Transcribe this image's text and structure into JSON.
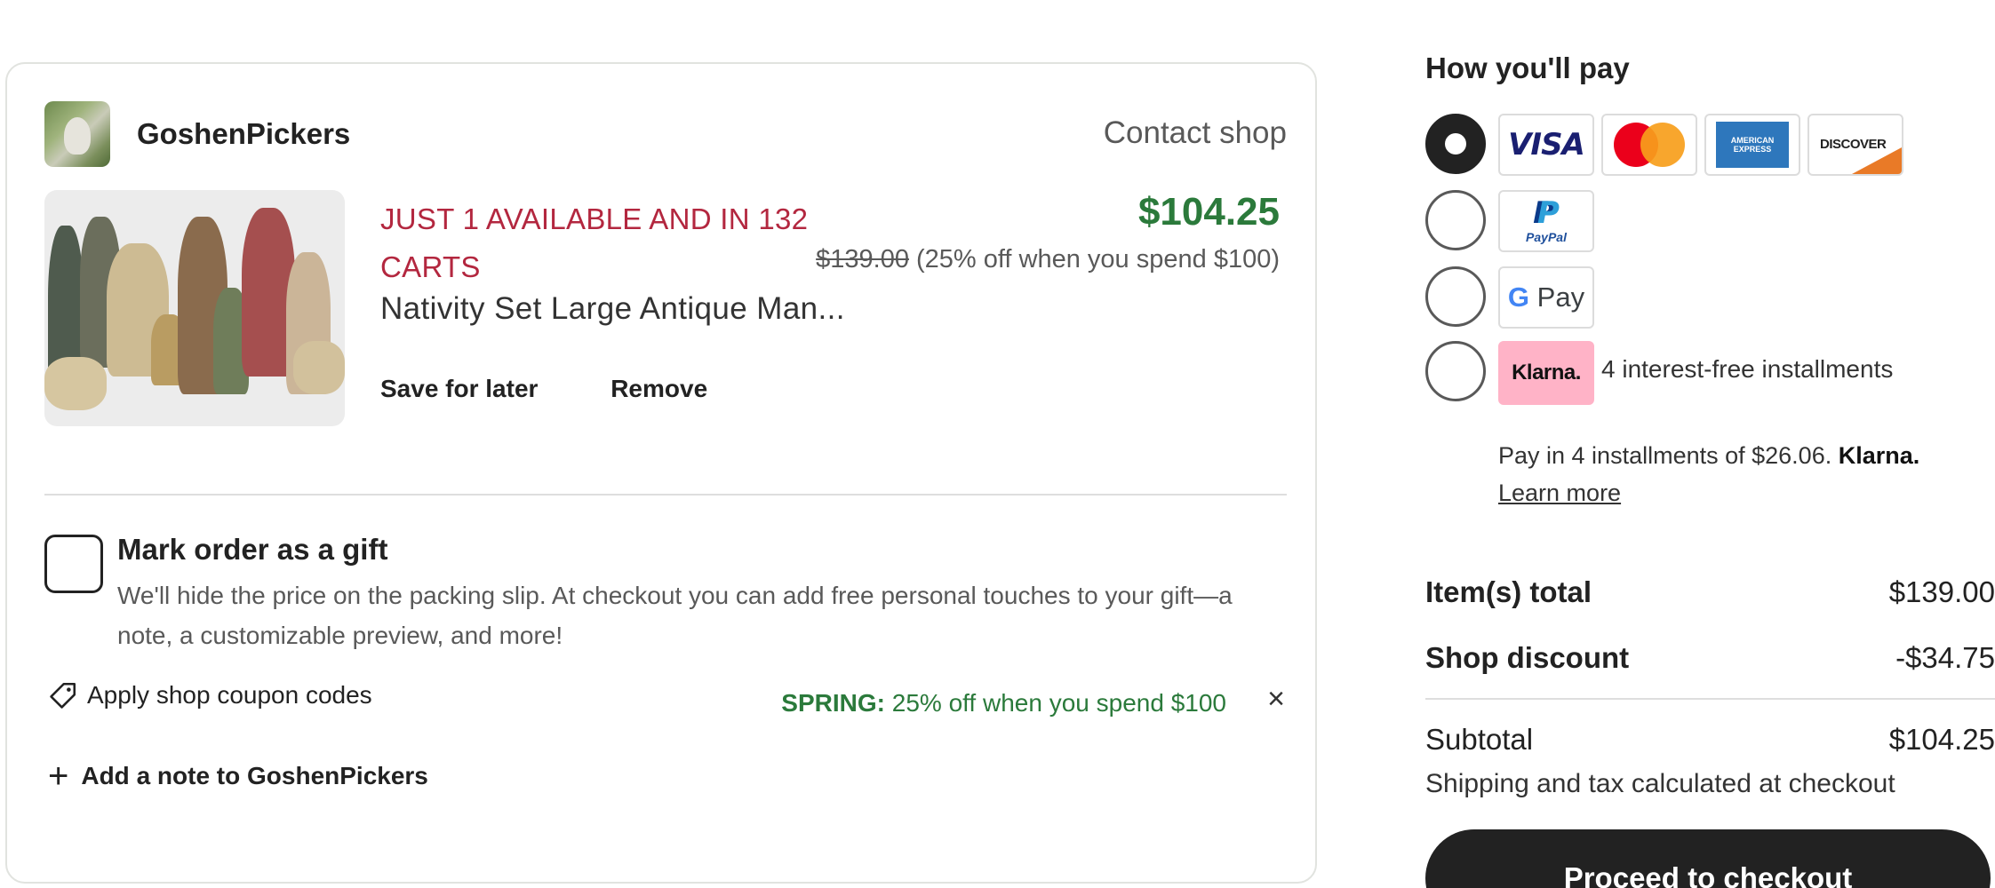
{
  "shop": {
    "name": "GoshenPickers",
    "contact_label": "Contact shop"
  },
  "item": {
    "stock_message": "JUST 1 AVAILABLE AND IN 132 CARTS",
    "title": "Nativity Set Large Antique Man...",
    "price": "$104.25",
    "original_price": "$139.00",
    "discount_note": "(25% off when you spend $100)",
    "save_for_later_label": "Save for later",
    "remove_label": "Remove"
  },
  "gift": {
    "title": "Mark order as a gift",
    "description": "We'll hide the price on the packing slip. At checkout you can add free personal touches to your gift—a note, a customizable preview, and more!",
    "checked": false
  },
  "coupon": {
    "link_label": "Apply shop coupon codes",
    "code": "SPRING:",
    "code_description": "25% off when you spend $100",
    "remove_symbol": "×"
  },
  "note": {
    "plus_symbol": "+",
    "label": "Add a note to GoshenPickers"
  },
  "payment": {
    "title": "How you'll pay",
    "selected": "card",
    "cards": {
      "visa": "VISA",
      "amex": "AMERICAN EXPRESS",
      "discover": "DISCOVER"
    },
    "paypal": {
      "text": "PayPal"
    },
    "gpay": {
      "g": "G",
      "text": "Pay"
    },
    "klarna": {
      "badge": "Klarna.",
      "description": "4 interest-free installments",
      "info": "Pay in 4 installments of $26.06.",
      "brand": "Klarna.",
      "learn_more": "Learn more"
    }
  },
  "summary": {
    "items_total_label": "Item(s) total",
    "items_total_value": "$139.00",
    "shop_discount_label": "Shop discount",
    "shop_discount_value": "-$34.75",
    "subtotal_label": "Subtotal",
    "subtotal_value": "$104.25",
    "shipping_note": "Shipping and tax calculated at checkout",
    "checkout_label": "Proceed to checkout"
  },
  "colors": {
    "stock_red": "#b3273f",
    "price_green": "#2b7a3b",
    "klarna_pink": "#ffb3c7",
    "button_dark": "#222222"
  },
  "icons": [
    "shop-avatar",
    "tag-icon",
    "close-icon",
    "plus-icon"
  ]
}
